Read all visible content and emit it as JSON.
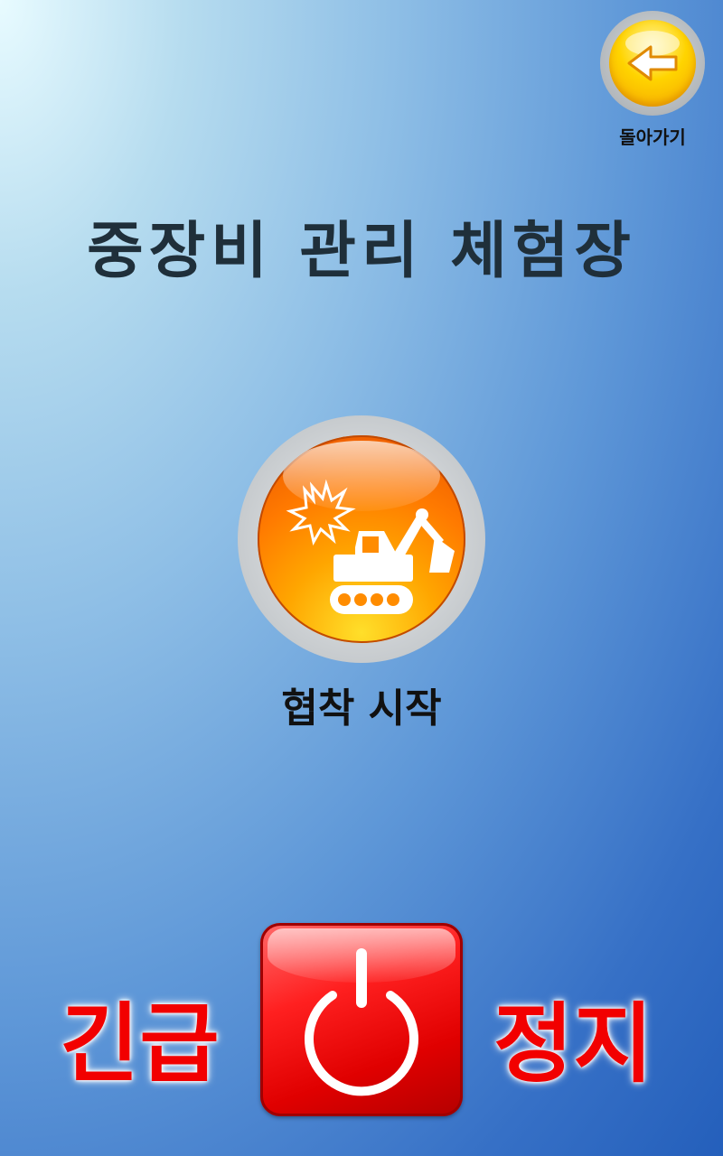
{
  "header": {
    "back_button": {
      "label": "돌아가기",
      "icon": "arrow-left-icon"
    },
    "title": "중장비 관리 체험장"
  },
  "main": {
    "start_button": {
      "icon": "excavator-icon",
      "label": "협착 시작"
    }
  },
  "emergency_stop": {
    "left_text": "긴급",
    "right_text": "정지",
    "icon": "power-icon"
  },
  "colors": {
    "accent_orange": "#ff7a00",
    "back_yellow": "#ffd400",
    "emergency_red": "#f20000",
    "title_dark": "#1f2f3a"
  }
}
